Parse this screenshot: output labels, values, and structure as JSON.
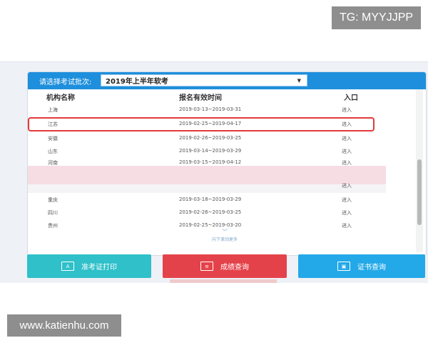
{
  "badges": {
    "tg": "TG: MYYJJPP",
    "website": "www.katienhu.com"
  },
  "batch_selector": {
    "label": "请选择考试批次:",
    "value": "2019年上半年软考"
  },
  "table": {
    "headers": [
      "机构名称",
      "报名有效时间",
      "入口"
    ],
    "rows": [
      {
        "name": "上海",
        "time": "2019-03-13~2019-03-31",
        "entry": "进入"
      },
      {
        "name": "江苏",
        "time": "2019-02-25~2019-04-17",
        "entry": "进入"
      },
      {
        "name": "安徽",
        "time": "2019-02-26~2019-03-25",
        "entry": "进入"
      },
      {
        "name": "山东",
        "time": "2019-03-14~2019-03-29",
        "entry": "进入"
      },
      {
        "name": "河南",
        "time": "2019-03-15~2019-04-12",
        "entry": "进入"
      },
      {
        "name": "",
        "time": "",
        "entry": "进入"
      },
      {
        "name": "重庆",
        "time": "2019-03-18~2019-03-29",
        "entry": "进入"
      },
      {
        "name": "四川",
        "time": "2019-02-26~2019-03-25",
        "entry": "进入"
      },
      {
        "name": "贵州",
        "time": "2019-02-25~2019-03-20",
        "entry": "进入"
      }
    ],
    "more_hint": "向下滚动更多"
  },
  "buttons": {
    "ticket": {
      "label": "准考证打印",
      "icon_text": "A"
    },
    "score": {
      "label": "成绩查询",
      "icon_text": "≡"
    },
    "cert": {
      "label": "证书查询",
      "icon_text": "▣"
    }
  },
  "colors": {
    "header_blue": "#1e8fdc",
    "highlight_red": "#e23a3a",
    "btn_teal": "#2fc0c9",
    "btn_red": "#e4424a",
    "btn_blue": "#23a9e8"
  }
}
